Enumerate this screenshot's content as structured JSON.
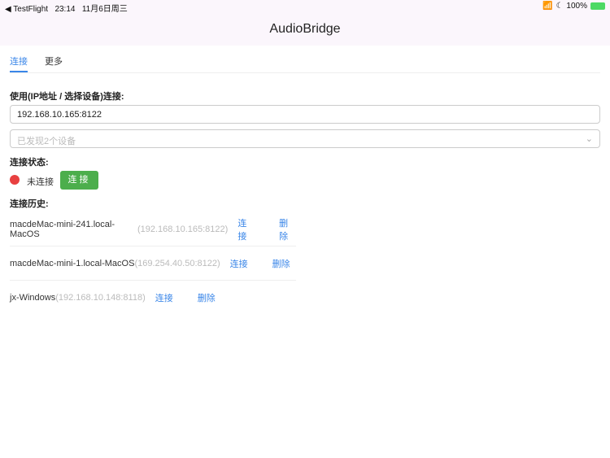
{
  "status": {
    "back": "◀ TestFlight",
    "time": "23:14",
    "date": "11月6日周三",
    "battery": "100%"
  },
  "title": "AudioBridge",
  "tabs": [
    {
      "label": "连接"
    },
    {
      "label": "更多"
    }
  ],
  "connect": {
    "label": "使用(IP地址 / 选择设备)连接:",
    "ip_value": "192.168.10.165:8122",
    "devices_placeholder": "已发现2个设备"
  },
  "state": {
    "label": "连接状态:",
    "value": "未连接",
    "button": "连接"
  },
  "history": {
    "label": "连接历史:",
    "items": [
      {
        "name": "macdeMac-mini-241.local-MacOS",
        "ip": "(192.168.10.165:8122)",
        "connect": "连接",
        "delete": "删除"
      },
      {
        "name": "macdeMac-mini-1.local-MacOS",
        "ip": "(169.254.40.50:8122)",
        "connect": "连接",
        "delete": "删除"
      },
      {
        "name": "jx-Windows",
        "ip": "(192.168.10.148:8118)",
        "connect": "连接",
        "delete": "删除"
      }
    ]
  }
}
